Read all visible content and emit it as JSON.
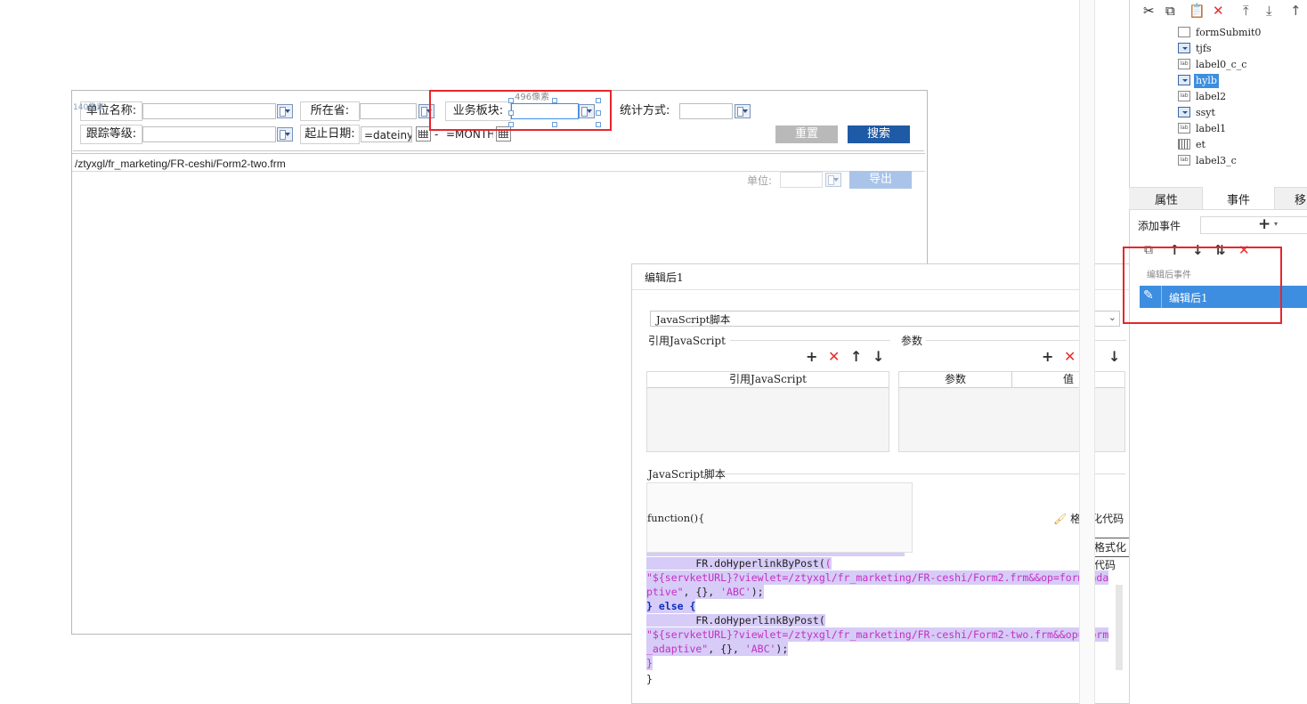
{
  "form": {
    "row1": {
      "unit_name_label": "单位名称:",
      "province_label": "所在省:",
      "business_label": "业务板块:",
      "stat_label": "统计方式:"
    },
    "row2": {
      "follow_label": "跟踪等级:",
      "date_label": "起止日期:",
      "date_start_value": "=dateinye",
      "date_sep": "-",
      "date_end_value": "=MONTH"
    },
    "reset_label": "重置",
    "search_label": "搜索",
    "width_hint": "496像素",
    "left_hint": "140像素",
    "path_text": "/ztyxgl/fr_marketing/FR-ceshi/Form2-two.frm",
    "unit_label": "单位:",
    "export_label": "导出"
  },
  "dialog": {
    "title": "编辑后1",
    "script_type": "JavaScript脚本",
    "ref_js_section": "引用JavaScript",
    "params_section": "参数",
    "ref_js_header": "引用JavaScript",
    "param_header": "参数",
    "value_header": "值",
    "script_section": "JavaScript脚本",
    "code_first_line": "function(){",
    "format_code_label": "格式化代码",
    "format_code_tooltip": "格式化代码",
    "code": {
      "l1": "        FR.doHyperlinkByPost(",
      "l2": "\"${servketURL}?viewlet=/ztyxgl/fr_marketing/FR-ceshi/Form2.frm&&op=form_ada",
      "l3a": "ptive\"",
      "l3b": ", {}, ",
      "l3c": "'ABC'",
      "l3d": ");",
      "l4a": "} ",
      "l4b": "else",
      "l4c": " {",
      "l5": "        FR.doHyperlinkByPost(",
      "l6": "\"${servketURL}?viewlet=/ztyxgl/fr_marketing/FR-ceshi/Form2-two.frm&&op=form",
      "l7a": "_adaptive\"",
      "l7b": ", {}, ",
      "l7c": "'ABC'",
      "l7d": ");",
      "l8": "}",
      "l9": "}"
    }
  },
  "tree": {
    "items": [
      {
        "label": "formSubmit0",
        "icon": "form-submit-icon"
      },
      {
        "label": "tjfs",
        "icon": "combo-icon"
      },
      {
        "label": "label0_c_c",
        "icon": "label-icon"
      },
      {
        "label": "hylb",
        "icon": "combo-icon"
      },
      {
        "label": "label2",
        "icon": "label-icon"
      },
      {
        "label": "ssyt",
        "icon": "combo-icon"
      },
      {
        "label": "label1",
        "icon": "label-icon"
      },
      {
        "label": "et",
        "icon": "grid-icon"
      },
      {
        "label": "label3_c",
        "icon": "label-icon"
      }
    ],
    "label_icon_text": "lab"
  },
  "panel": {
    "tab_properties": "属性",
    "tab_events": "事件",
    "tab_move": "移",
    "add_event_label": "添加事件",
    "event_group": "编辑后事件",
    "event_item": "编辑后1"
  },
  "colors": {
    "accent": "#1f5aa6",
    "selection": "#3d8ee0",
    "highlight": "#e8262b"
  }
}
